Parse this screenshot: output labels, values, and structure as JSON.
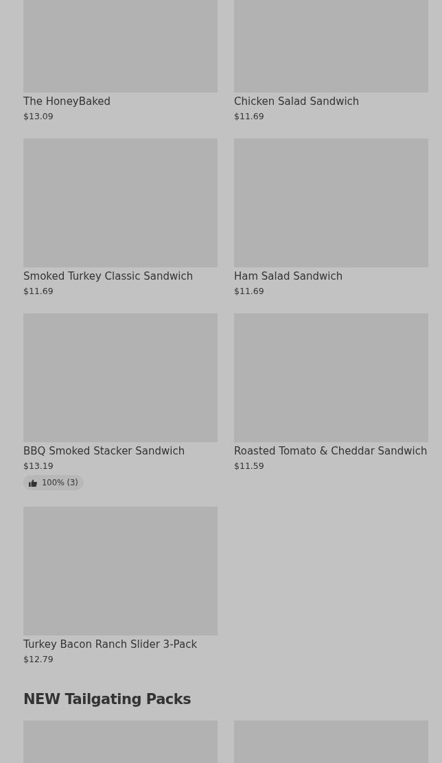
{
  "products": [
    {
      "name": "The HoneyBaked",
      "price": "$13.09"
    },
    {
      "name": "Chicken Salad Sandwich",
      "price": "$11.69"
    },
    {
      "name": "Smoked Turkey Classic Sandwich",
      "price": "$11.69"
    },
    {
      "name": "Ham Salad Sandwich",
      "price": "$11.69"
    },
    {
      "name": "BBQ Smoked Stacker Sandwich",
      "price": "$13.19",
      "rating": "100% (3)"
    },
    {
      "name": "Roasted Tomato & Cheddar Sandwich",
      "price": "$11.59"
    },
    {
      "name": "Turkey Bacon Ranch Slider 3-Pack",
      "price": "$12.79"
    }
  ],
  "section": {
    "title": "NEW Tailgating Packs"
  }
}
